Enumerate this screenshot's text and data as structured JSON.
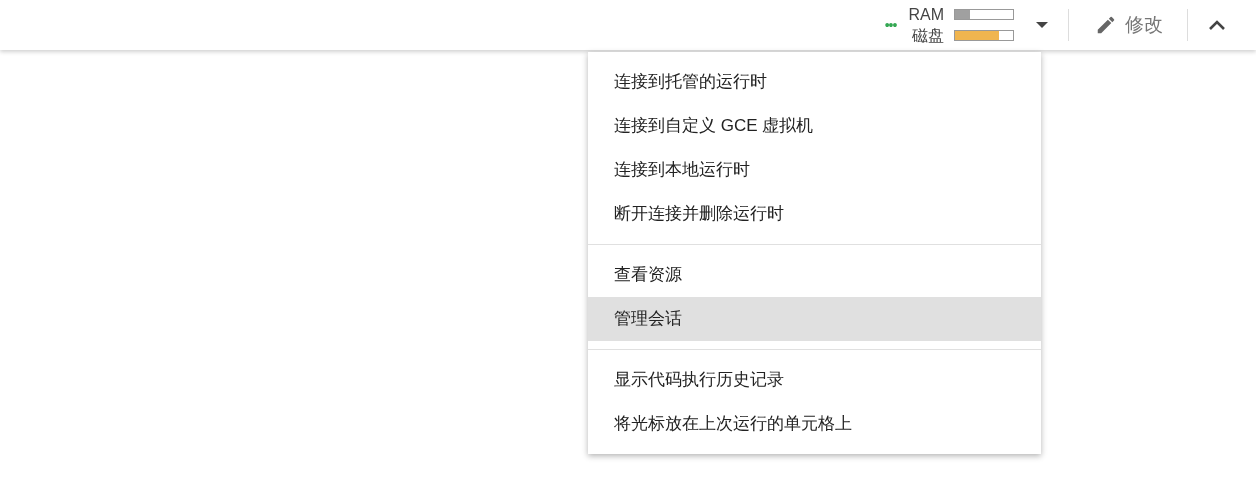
{
  "toolbar": {
    "status_dots": "•••",
    "resources": [
      {
        "label": "RAM",
        "level": 0.25,
        "color": "#a0a0a0"
      },
      {
        "label": "磁盘",
        "level": 0.75,
        "color": "#f0b54f"
      }
    ],
    "edit_button": {
      "label": "修改"
    }
  },
  "menu": {
    "groups": [
      {
        "items": [
          {
            "label": "连接到托管的运行时",
            "selected": false
          },
          {
            "label": "连接到自定义 GCE 虚拟机",
            "selected": false
          },
          {
            "label": "连接到本地运行时",
            "selected": false
          },
          {
            "label": "断开连接并删除运行时",
            "selected": false
          }
        ]
      },
      {
        "items": [
          {
            "label": "查看资源",
            "selected": false
          },
          {
            "label": "管理会话",
            "selected": true
          }
        ]
      },
      {
        "items": [
          {
            "label": "显示代码执行历史记录",
            "selected": false
          },
          {
            "label": "将光标放在上次运行的单元格上",
            "selected": false
          }
        ]
      }
    ]
  }
}
